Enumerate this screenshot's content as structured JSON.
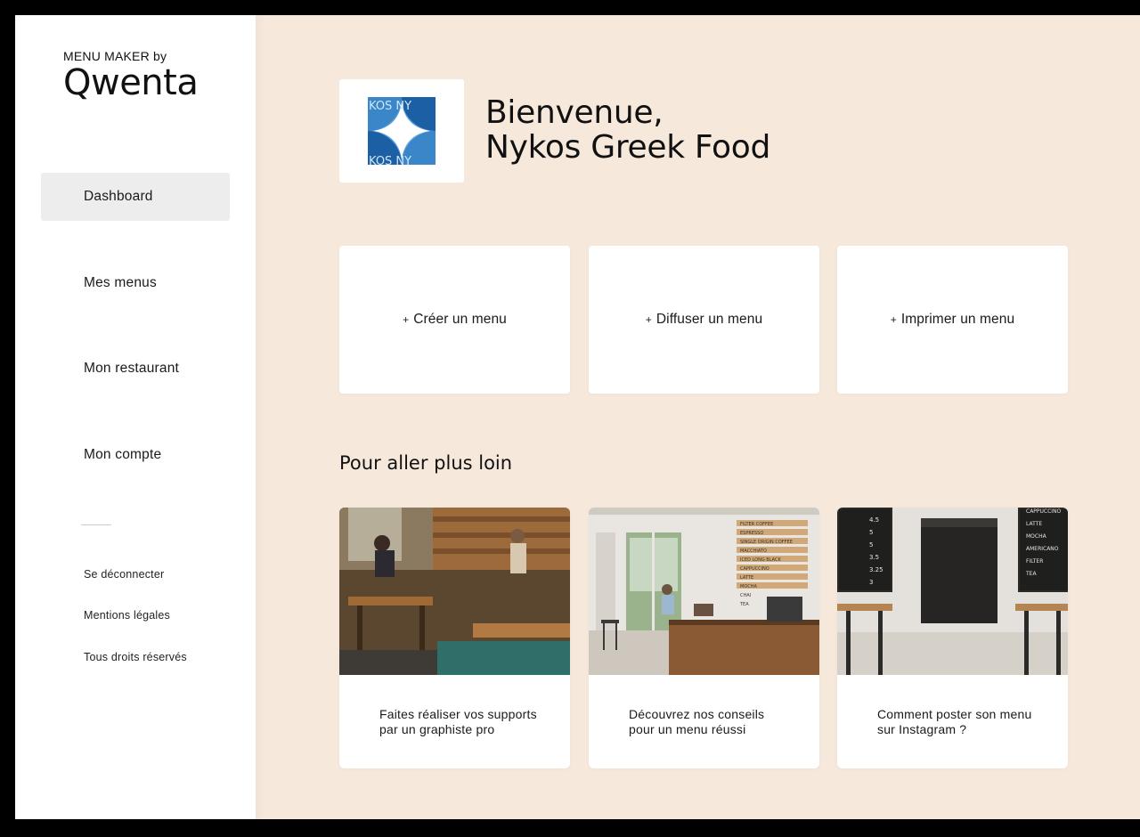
{
  "sidebar": {
    "brand_sub": "MENU MAKER by",
    "brand_name": "Qwenta",
    "nav": [
      {
        "label": "Dashboard",
        "active": true
      },
      {
        "label": "Mes menus",
        "active": false
      },
      {
        "label": "Mon restaurant",
        "active": false
      },
      {
        "label": "Mon compte",
        "active": false
      }
    ],
    "footer_links": [
      "Se déconnecter",
      "Mentions légales",
      "Tous droits réservés"
    ]
  },
  "header": {
    "logo_text_top": "KOS NY",
    "logo_text_bottom": "KOS NY",
    "welcome_line1": "Bienvenue,",
    "welcome_line2": "Nykos Greek Food"
  },
  "actions": [
    {
      "icon": "plus-icon",
      "label": "Créer un menu"
    },
    {
      "icon": "plus-icon",
      "label": "Diffuser un menu"
    },
    {
      "icon": "plus-icon",
      "label": "Imprimer un menu"
    }
  ],
  "section_title": "Pour aller plus loin",
  "articles": [
    {
      "text": "Faites réaliser vos supports par un graphiste pro",
      "image": "cafe-interior-photo"
    },
    {
      "text": "Découvrez nos conseils pour un menu réussi",
      "image": "coffee-shop-counter-photo"
    },
    {
      "text": "Comment poster son menu sur Instagram ?",
      "image": "cafe-chalkboard-menu-photo"
    }
  ],
  "photo_menu_board_2": [
    "FILTER COFFEE",
    "ESPRESSO",
    "SINGLE ORIGIN COFFEE",
    "MACCHIATO",
    "ICED LONG BLACK",
    "CAPPUCCINO",
    "LATTE",
    "MOCHA",
    "CHAI",
    "TEA"
  ],
  "photo_menu_board_3_left": [
    "4.5",
    "5",
    "5",
    "3.5",
    "3.25",
    "3"
  ],
  "photo_menu_board_3_right": [
    "CAPPUCCINO",
    "LATTE",
    "MOCHA",
    "AMERICANO",
    "FILTER",
    "TEA"
  ],
  "colors": {
    "background": "#f6e9dc",
    "active_nav": "#ededed",
    "logo_blue": "#3a86c8",
    "logo_dark_blue": "#1d5fa5"
  }
}
